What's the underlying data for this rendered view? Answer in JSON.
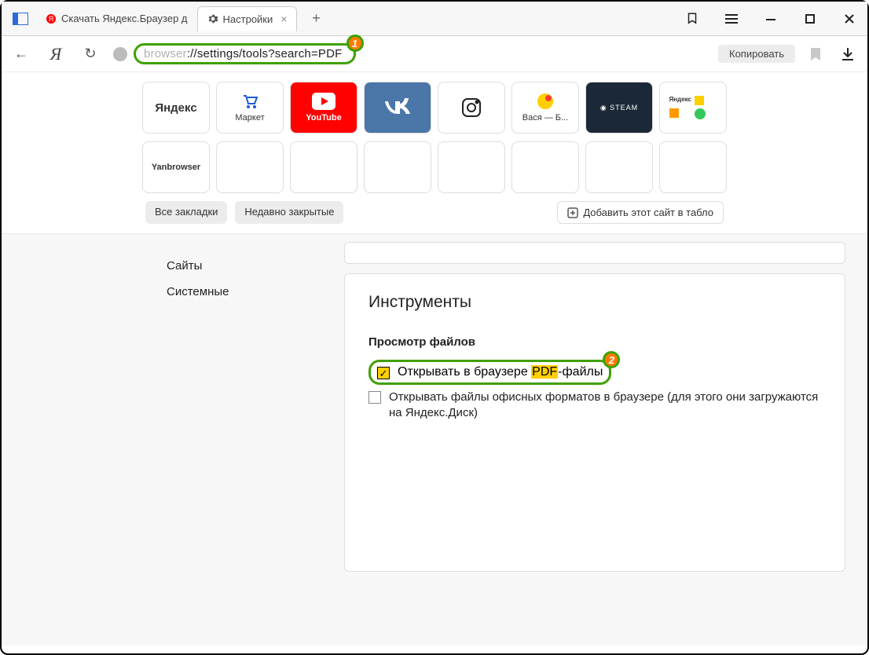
{
  "titlebar": {
    "tab1_label": "Скачать Яндекс.Браузер д",
    "tab2_label": "Настройки",
    "callout1": "1"
  },
  "addressbar": {
    "url_dim": "browser",
    "url_rest": "://settings/tools?search=PDF",
    "copy_label": "Копировать"
  },
  "tiles_row1": [
    {
      "label": "Яндекс",
      "variant": "plain",
      "textOnly": true
    },
    {
      "label": "Маркет",
      "variant": "plain",
      "icon": "cart"
    },
    {
      "label": "YouTube",
      "variant": "red",
      "icon": "yt"
    },
    {
      "label": "",
      "variant": "blue",
      "icon": "vk"
    },
    {
      "label": "",
      "variant": "plain",
      "icon": "ig"
    },
    {
      "label": "Вася — Б...",
      "variant": "plain",
      "icon": "ydisk"
    },
    {
      "label": "",
      "variant": "dark",
      "icon": "steam"
    },
    {
      "label": "",
      "variant": "plain",
      "icon": "mini"
    }
  ],
  "tiles_row2": [
    {
      "label": "Yanbrowser"
    },
    {
      "label": ""
    },
    {
      "label": ""
    },
    {
      "label": ""
    },
    {
      "label": ""
    },
    {
      "label": ""
    },
    {
      "label": ""
    },
    {
      "label": ""
    }
  ],
  "chips": {
    "all_bookmarks": "Все закладки",
    "recently_closed": "Недавно закрытые",
    "add_to_dial": "Добавить этот сайт в табло"
  },
  "sidebar": {
    "items": [
      "Сайты",
      "Системные"
    ]
  },
  "settings": {
    "section_title": "Инструменты",
    "group_title": "Просмотр файлов",
    "opt1_pre": "Открывать в браузере ",
    "opt1_hl": "PDF",
    "opt1_post": "-файлы",
    "opt2": "Открывать файлы офисных форматов в браузере (для этого они загружаются на Яндекс.Диск)",
    "callout2": "2"
  }
}
